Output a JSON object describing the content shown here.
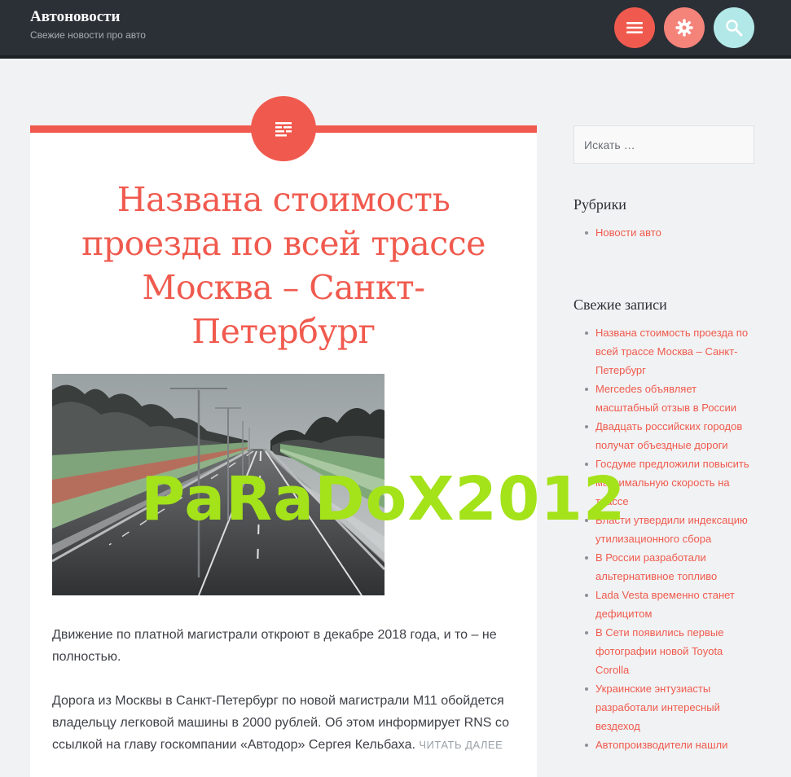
{
  "header": {
    "site_title": "Автоновости",
    "site_description": "Свежие новости про авто",
    "buttons": [
      {
        "icon": "menu-icon",
        "color": "#f05a4e"
      },
      {
        "icon": "gear-icon",
        "color": "#f4837a"
      },
      {
        "icon": "search-icon",
        "color": "#b3e8e8"
      }
    ]
  },
  "post": {
    "format_icon": "text-format-icon",
    "title": "Названа стоимость проезда по всей трассе Москва – Санкт-Петербург",
    "paragraph1": "Движение по платной магистрали откроют в декабре 2018 года, и то – не полностью.",
    "paragraph2": "Дорога из Москвы в Санкт-Петербург по новой магистрали М11 обойдется владельцу легковой машины в 2000 рублей. Об этом информирует RNS со ссылкой на главу госкомпании «Автодор» Сергея Кельбаха.",
    "read_more": "Читать далее"
  },
  "watermark": "PaRaDoX2012",
  "sidebar": {
    "search_placeholder": "Искать …",
    "categories_title": "Рубрики",
    "categories": [
      "Новости авто"
    ],
    "recent_title": "Свежие записи",
    "recent_posts": [
      "Названа стоимость проезда по всей трассе Москва – Санкт-Петербург",
      "Mercedes объявляет масштабный отзыв в России",
      "Двадцать российских городов получат объездные дороги",
      "Госдуме предложили повысить максимальную скорость на трассе",
      "Власти утвердили индексацию утилизационного сбора",
      "В России разработали альтернативное топливо",
      "Lada Vesta временно станет дефицитом",
      "В Сети появились первые фотографии новой Toyota Corolla",
      "Украинские энтузиасты разработали интересный вездеход",
      "Автопроизводители нашли"
    ]
  },
  "colors": {
    "accent": "#f05a4e",
    "header_bg": "#2b2f36",
    "page_bg": "#f1f2f3",
    "watermark": "#a4e21a"
  }
}
